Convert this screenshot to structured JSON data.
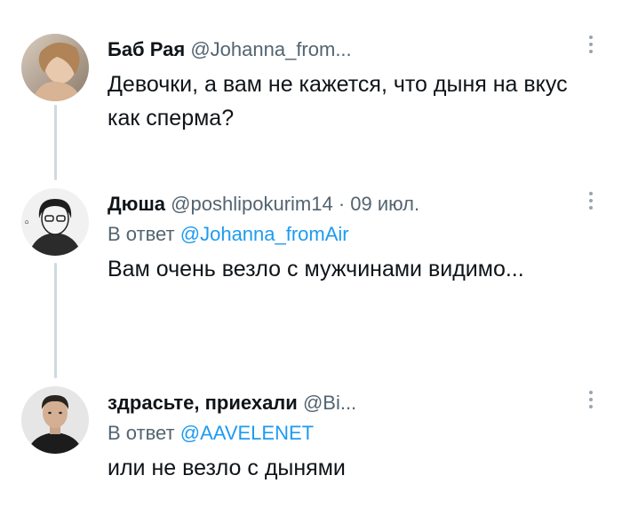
{
  "tweets": [
    {
      "name": "Баб Рая",
      "meta": "@Johanna_from...",
      "reply_label": "",
      "reply_handle": "",
      "text": "Девочки, а вам не кажется, что дыня на вкус как сперма?",
      "avatar_icon": "avatar-photo-woman"
    },
    {
      "name": "Дюша",
      "meta": "@poshlipokurim14 · 09 июл.",
      "reply_label": "В ответ",
      "reply_handle": "@Johanna_fromAir",
      "text": "Вам очень везло с мужчинами видимо...",
      "avatar_icon": "avatar-drawing-character"
    },
    {
      "name": "здрасьте, приехали",
      "meta": "@Bi...",
      "reply_label": "В ответ",
      "reply_handle": "@AAVELENET",
      "text": "или не везло с дынями",
      "avatar_icon": "avatar-photo-man"
    }
  ],
  "colors": {
    "text": "#0f1419",
    "muted": "#536471",
    "link": "#1d9bf0",
    "thread_line": "#cfd9de"
  }
}
